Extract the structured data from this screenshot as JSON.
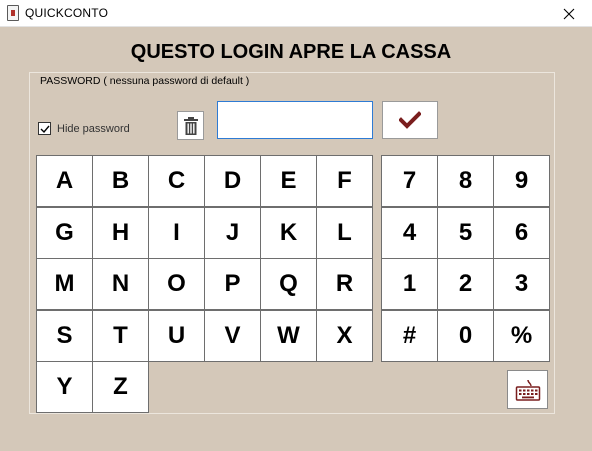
{
  "window": {
    "title": "QUICKCONTO",
    "icon": "app-icon",
    "close_icon": "close-icon"
  },
  "heading": "QUESTO LOGIN APRE LA CASSA",
  "group_label": "PASSWORD ( nessuna password di default )",
  "hide_password": {
    "label": "Hide password",
    "checked": true
  },
  "password_field": {
    "value": ""
  },
  "icons": {
    "clear": "trash-icon",
    "confirm": "checkmark-icon",
    "keyboard": "keyboard-icon"
  },
  "colors": {
    "background": "#d4c8b9",
    "accent": "#7a1e1e",
    "input_focus": "#2e7bd4"
  },
  "letter_keys": [
    "A",
    "B",
    "C",
    "D",
    "E",
    "F",
    "G",
    "H",
    "I",
    "J",
    "K",
    "L",
    "M",
    "N",
    "O",
    "P",
    "Q",
    "R",
    "S",
    "T",
    "U",
    "V",
    "W",
    "X",
    "Y",
    "Z"
  ],
  "digit_keys": [
    "7",
    "8",
    "9",
    "4",
    "5",
    "6",
    "1",
    "2",
    "3",
    "#",
    "0",
    "%"
  ]
}
